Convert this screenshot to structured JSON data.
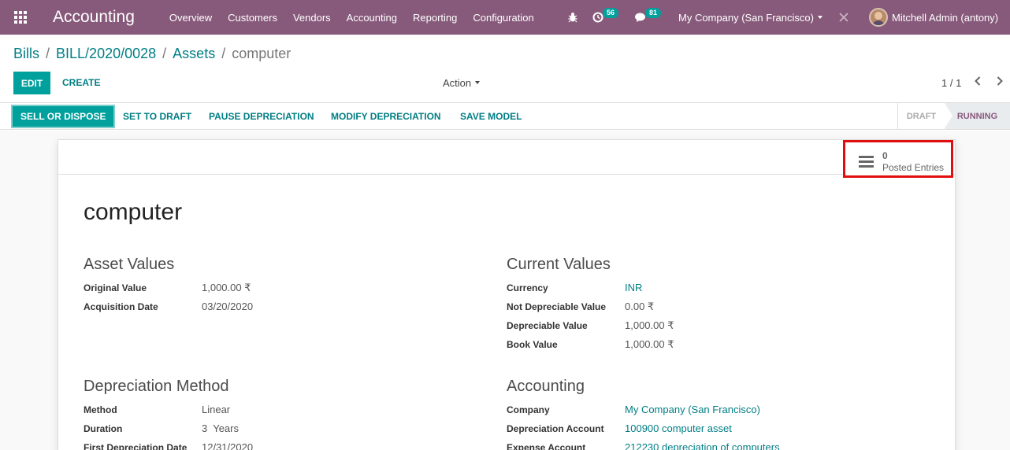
{
  "topbar": {
    "app_name": "Accounting",
    "menu": [
      "Overview",
      "Customers",
      "Vendors",
      "Accounting",
      "Reporting",
      "Configuration"
    ],
    "activity_count": "56",
    "message_count": "81",
    "company": "My Company (San Francisco)",
    "user": "Mitchell Admin (antony)"
  },
  "control": {
    "breadcrumb": [
      "Bills",
      "BILL/2020/0028",
      "Assets"
    ],
    "current": "computer",
    "edit_label": "EDIT",
    "create_label": "CREATE",
    "action_label": "Action",
    "pager": "1 / 1"
  },
  "statusbar": {
    "buttons": [
      "SELL OR DISPOSE",
      "SET TO DRAFT",
      "PAUSE DEPRECIATION",
      "MODIFY DEPRECIATION",
      "SAVE MODEL"
    ],
    "stages": [
      "DRAFT",
      "RUNNING"
    ],
    "active_stage": "RUNNING"
  },
  "smart_button": {
    "count": "0",
    "label": "Posted Entries"
  },
  "record": {
    "name": "computer",
    "asset_values": {
      "title": "Asset Values",
      "fields": [
        {
          "label": "Original Value",
          "value": "1,000.00 ₹"
        },
        {
          "label": "Acquisition Date",
          "value": "03/20/2020"
        }
      ]
    },
    "current_values": {
      "title": "Current Values",
      "fields": [
        {
          "label": "Currency",
          "value": "INR"
        },
        {
          "label": "Not Depreciable Value",
          "value": "0.00 ₹"
        },
        {
          "label": "Depreciable Value",
          "value": "1,000.00 ₹"
        },
        {
          "label": "Book Value",
          "value": "1,000.00 ₹"
        }
      ]
    },
    "depreciation_method": {
      "title": "Depreciation Method",
      "fields": [
        {
          "label": "Method",
          "value": "Linear"
        },
        {
          "label": "Duration",
          "value": "3  Years"
        },
        {
          "label": "First Depreciation Date",
          "value": "12/31/2020"
        }
      ]
    },
    "accounting": {
      "title": "Accounting",
      "fields": [
        {
          "label": "Company",
          "value": "My Company (San Francisco)"
        },
        {
          "label": "Depreciation Account",
          "value": "100900 computer asset"
        },
        {
          "label": "Expense Account",
          "value": "212230 depreciation of computers"
        }
      ]
    }
  },
  "colors": {
    "navbar": "#875a7b",
    "primary": "#00a09d",
    "link": "#017e84",
    "highlight": "#e20d0d"
  }
}
